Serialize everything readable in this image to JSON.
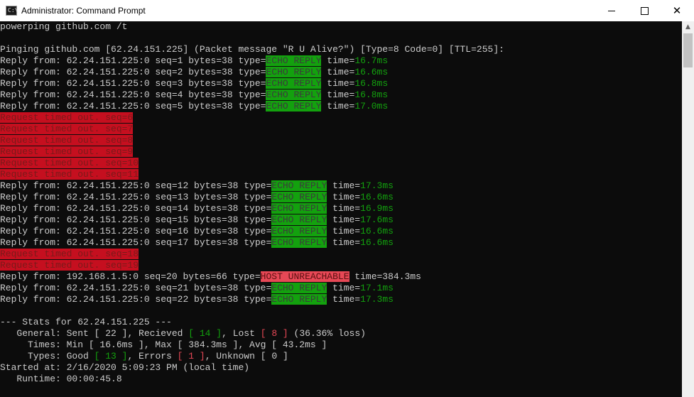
{
  "window": {
    "title": "Administrator: Command Prompt",
    "icon": "command-prompt-icon",
    "icon_glyph": "C:\\",
    "controls": {
      "minimize": "minimize-icon",
      "maximize": "maximize-icon",
      "close": "close-icon",
      "close_glyph": "✕"
    }
  },
  "console": {
    "command": "powerping github.com /t",
    "header": "Pinging github.com [62.24.151.225] (Packet message \"R U Alive?\") [Type=8 Code=0] [TTL=255]:",
    "block1": [
      {
        "prefix": "Reply from: 62.24.151.225:0 seq=1 bytes=38 type=",
        "type": "ECHO REPLY",
        "gap": " ",
        "time_label": "time=",
        "time": "16.7ms"
      },
      {
        "prefix": "Reply from: 62.24.151.225:0 seq=2 bytes=38 type=",
        "type": "ECHO REPLY",
        "gap": " ",
        "time_label": "time=",
        "time": "16.6ms"
      },
      {
        "prefix": "Reply from: 62.24.151.225:0 seq=3 bytes=38 type=",
        "type": "ECHO REPLY",
        "gap": " ",
        "time_label": "time=",
        "time": "16.8ms"
      },
      {
        "prefix": "Reply from: 62.24.151.225:0 seq=4 bytes=38 type=",
        "type": "ECHO REPLY",
        "gap": " ",
        "time_label": "time=",
        "time": "16.8ms"
      },
      {
        "prefix": "Reply from: 62.24.151.225:0 seq=5 bytes=38 type=",
        "type": "ECHO REPLY",
        "gap": " ",
        "time_label": "time=",
        "time": "17.0ms"
      }
    ],
    "timeouts1": [
      "Request timed out. seq=6",
      "Request timed out. seq=7",
      "Request timed out. seq=8",
      "Request timed out. seq=9",
      "Request timed out. seq=10",
      "Request timed out. seq=11"
    ],
    "block2": [
      {
        "prefix": "Reply from: 62.24.151.225:0 seq=12 bytes=38 type=",
        "type": "ECHO REPLY",
        "gap": " ",
        "time_label": "time=",
        "time": "17.3ms"
      },
      {
        "prefix": "Reply from: 62.24.151.225:0 seq=13 bytes=38 type=",
        "type": "ECHO REPLY",
        "gap": " ",
        "time_label": "time=",
        "time": "16.6ms"
      },
      {
        "prefix": "Reply from: 62.24.151.225:0 seq=14 bytes=38 type=",
        "type": "ECHO REPLY",
        "gap": " ",
        "time_label": "time=",
        "time": "16.9ms"
      },
      {
        "prefix": "Reply from: 62.24.151.225:0 seq=15 bytes=38 type=",
        "type": "ECHO REPLY",
        "gap": " ",
        "time_label": "time=",
        "time": "17.6ms"
      },
      {
        "prefix": "Reply from: 62.24.151.225:0 seq=16 bytes=38 type=",
        "type": "ECHO REPLY",
        "gap": " ",
        "time_label": "time=",
        "time": "16.6ms"
      },
      {
        "prefix": "Reply from: 62.24.151.225:0 seq=17 bytes=38 type=",
        "type": "ECHO REPLY",
        "gap": " ",
        "time_label": "time=",
        "time": "16.6ms"
      }
    ],
    "timeouts2": [
      "Request timed out. seq=18",
      "Request timed out. seq=19"
    ],
    "unreachable": {
      "prefix": "Reply from: 192.168.1.5:0 seq=20 bytes=66 type=",
      "type": "HOST UNREACHABLE",
      "rest": " time=384.3ms"
    },
    "block3": [
      {
        "prefix": "Reply from: 62.24.151.225:0 seq=21 bytes=38 type=",
        "type": "ECHO REPLY",
        "gap": " ",
        "time_label": "time=",
        "time": "17.1ms"
      },
      {
        "prefix": "Reply from: 62.24.151.225:0 seq=22 bytes=38 type=",
        "type": "ECHO REPLY",
        "gap": " ",
        "time_label": "time=",
        "time": "17.3ms"
      }
    ],
    "stats": {
      "heading": "--- Stats for 62.24.151.225 ---",
      "general": {
        "label": "   General: Sent [ ",
        "sent": "22",
        "mid1": " ], Recieved ",
        "lb": "[ ",
        "received": "14",
        "rb": " ]",
        "mid2": ", Lost ",
        "lost_lb": "[ ",
        "lost": "8",
        "lost_rb": " ]",
        "tail": " (36.36% loss)"
      },
      "times": "     Times: Min [ 16.6ms ], Max [ 384.3ms ], Avg [ 43.2ms ]",
      "types": {
        "label": "     Types: Good ",
        "good_lb": "[ ",
        "good": "13",
        "good_rb": " ]",
        "mid1": ", Errors ",
        "err_lb": "[ ",
        "errors": "1",
        "err_rb": " ]",
        "mid2": ", Unknown ",
        "unk_lb": "[ ",
        "unknown": "0",
        "unk_rb": " ]"
      },
      "started": "Started at: 2/16/2020 5:09:23 PM (local time)",
      "runtime": "   Runtime: 00:00:45.8"
    }
  },
  "colors": {
    "console_bg": "#0c0c0c",
    "console_fg": "#cccccc",
    "success": "#13a10e",
    "timeout": "#c50f1f",
    "error": "#e74856"
  }
}
